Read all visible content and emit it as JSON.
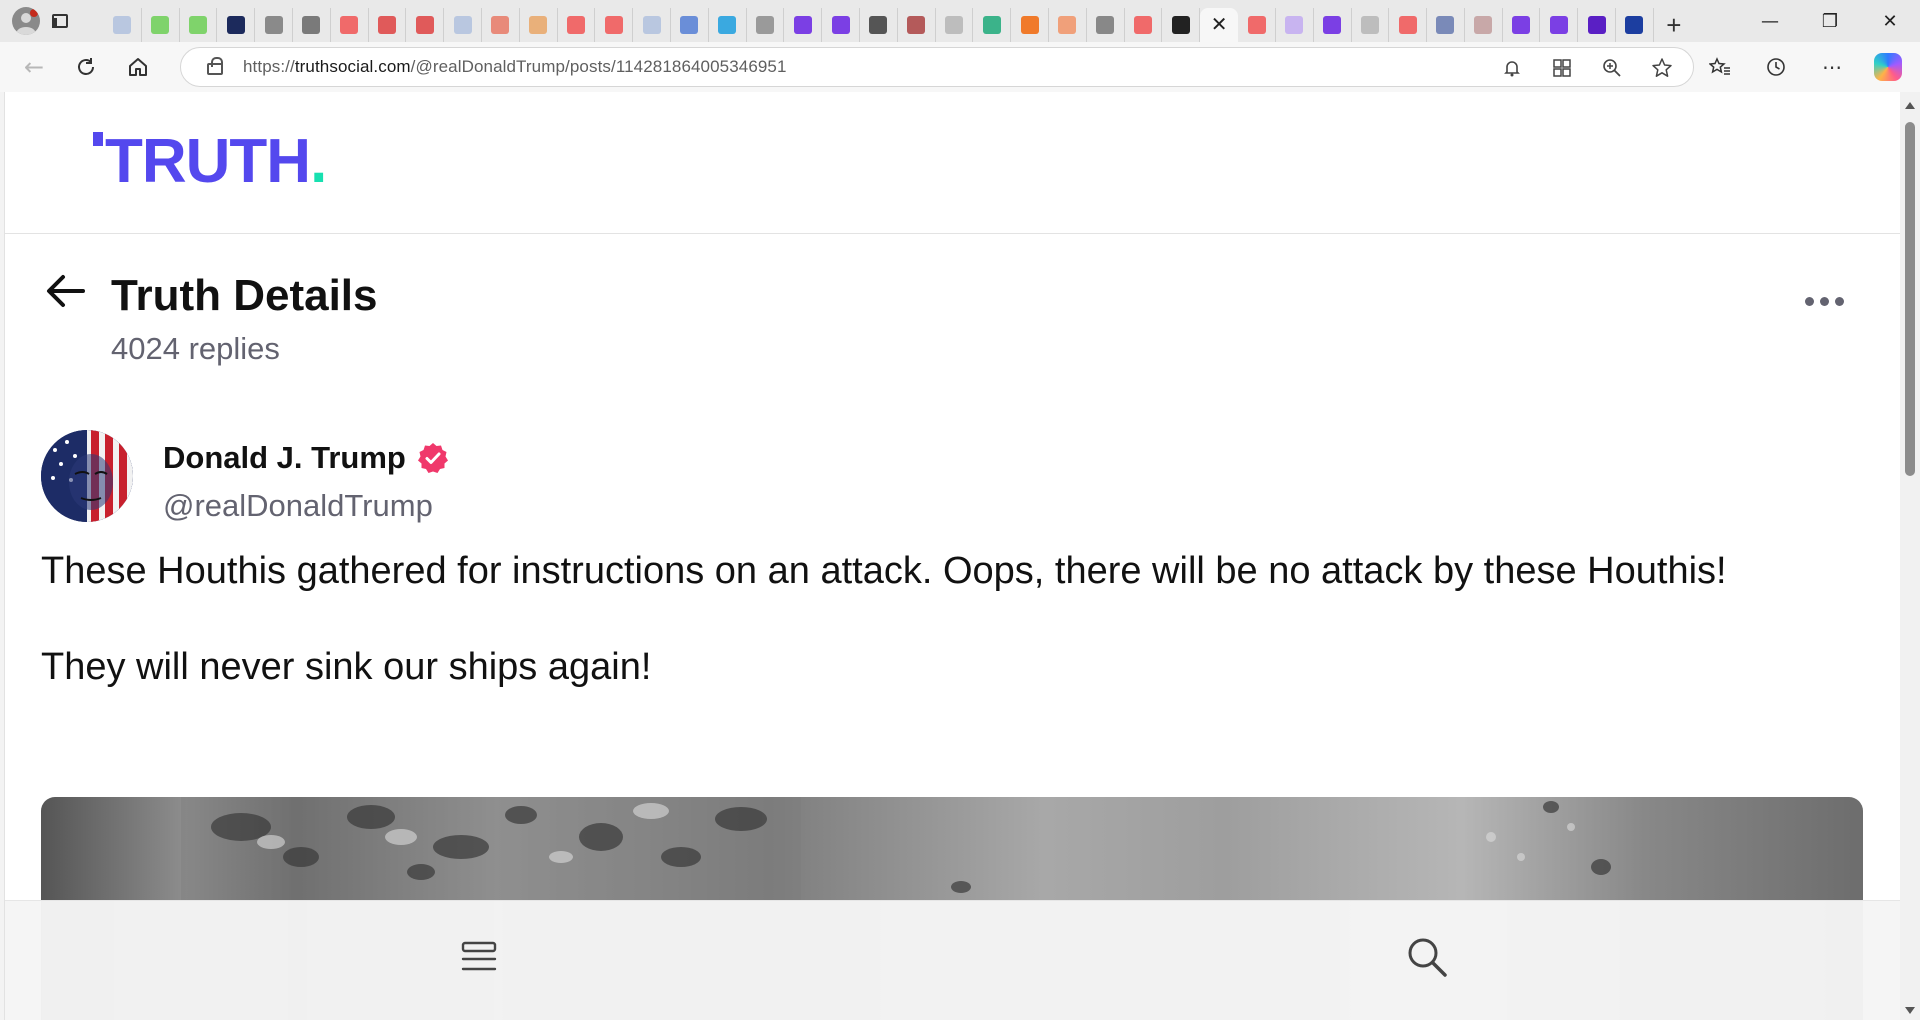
{
  "browser": {
    "tabs": [
      {
        "icon": "book-icon",
        "color": "#b9c7e0"
      },
      {
        "icon": "play-icon",
        "color": "#7fd36b"
      },
      {
        "icon": "play-icon",
        "color": "#7fd36b"
      },
      {
        "icon": "fox-news-icon",
        "color": "#1c2a5c"
      },
      {
        "icon": "document-icon",
        "color": "#8a8a8a"
      },
      {
        "icon": "forward-icon",
        "color": "#7a7a7a"
      },
      {
        "icon": "youtube-icon",
        "color": "#f06a6a"
      },
      {
        "icon": "r-icon",
        "color": "#e05a5a"
      },
      {
        "icon": "r-icon",
        "color": "#e05a5a"
      },
      {
        "icon": "book-icon",
        "color": "#b9c7e0"
      },
      {
        "icon": "pdf-icon",
        "color": "#e88a7a"
      },
      {
        "icon": "circle-icon",
        "color": "#e9b07a"
      },
      {
        "icon": "youtube-icon",
        "color": "#f06a6a"
      },
      {
        "icon": "youtube-icon",
        "color": "#f06a6a"
      },
      {
        "icon": "book-icon",
        "color": "#b9c7e0"
      },
      {
        "icon": "globe-icon",
        "color": "#6a8ed8"
      },
      {
        "icon": "c-icon",
        "color": "#3aa9e0"
      },
      {
        "icon": "document-icon",
        "color": "#9a9a9a"
      },
      {
        "icon": "yahoo-icon",
        "color": "#7b3fe4"
      },
      {
        "icon": "yahoo-icon",
        "color": "#7b3fe4"
      },
      {
        "icon": "br-icon",
        "color": "#555555"
      },
      {
        "icon": "s-icon",
        "color": "#b45a5a"
      },
      {
        "icon": "google-icon",
        "color": "#bdbdbd"
      },
      {
        "icon": "puzzle-icon",
        "color": "#3bb38a"
      },
      {
        "icon": "bookmark-icon",
        "color": "#f07a2a"
      },
      {
        "icon": "bookmark-icon",
        "color": "#f0a07a"
      },
      {
        "icon": "pen-icon",
        "color": "#888888"
      },
      {
        "icon": "youtube-icon",
        "color": "#f06a6a"
      },
      {
        "icon": "gp-icon",
        "color": "#222222"
      },
      {
        "icon": "close-icon",
        "color": "#222222",
        "active": true
      },
      {
        "icon": "youtube-icon",
        "color": "#f06a6a"
      },
      {
        "icon": "slash-icon",
        "color": "#c8b4f0"
      },
      {
        "icon": "yahoo-icon",
        "color": "#7b3fe4"
      },
      {
        "icon": "google-icon",
        "color": "#bdbdbd"
      },
      {
        "icon": "youtube-icon",
        "color": "#f06a6a"
      },
      {
        "icon": "globe-icon",
        "color": "#7a8ab8"
      },
      {
        "icon": "pdf-icon",
        "color": "#c8a8a8"
      },
      {
        "icon": "slash-icon",
        "color": "#7b3fe4"
      },
      {
        "icon": "slash-icon",
        "color": "#7b3fe4"
      },
      {
        "icon": "yahoo-icon",
        "color": "#5a1fc4"
      },
      {
        "icon": "h-icon",
        "color": "#1c3ea0"
      }
    ],
    "new_tab_label": "+",
    "url_prefix": "https://",
    "url_host": "truthsocial.com",
    "url_path": "/@realDonaldTrump/posts/114281864005346951"
  },
  "page": {
    "logo_text": "TRUTH",
    "logo_dot": ".",
    "title": "Truth Details",
    "replies": "4024 replies",
    "author_name": "Donald J. Trump",
    "handle": "@realDonaldTrump",
    "paragraphs": [
      "These Houthis gathered for instructions on an attack. Oops, there will be no attack by these Houthis!",
      "They will never sink our ships again!"
    ]
  },
  "colors": {
    "brand": "#5448ee",
    "brand_accent": "#17e0b0",
    "verified": "#f0386b",
    "muted_text": "#636370"
  }
}
